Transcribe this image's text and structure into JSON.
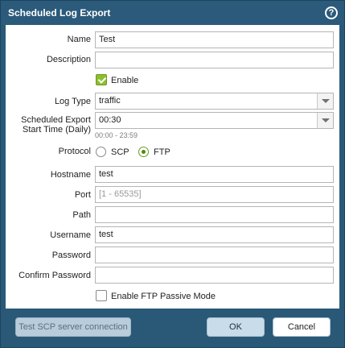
{
  "dialog": {
    "title": "Scheduled Log Export",
    "help_glyph": "?"
  },
  "form": {
    "name": {
      "label": "Name",
      "value": "Test"
    },
    "description": {
      "label": "Description",
      "value": ""
    },
    "enable": {
      "label": "Enable",
      "checked": true
    },
    "log_type": {
      "label": "Log Type",
      "value": "traffic"
    },
    "start_time": {
      "label_line1": "Scheduled Export",
      "label_line2": "Start Time (Daily)",
      "value": "00:30",
      "hint": "00:00 - 23:59"
    },
    "protocol": {
      "label": "Protocol",
      "options": [
        "SCP",
        "FTP"
      ],
      "selected": "FTP"
    },
    "hostname": {
      "label": "Hostname",
      "value": "test"
    },
    "port": {
      "label": "Port",
      "value": "",
      "placeholder": "[1 - 65535]"
    },
    "path": {
      "label": "Path",
      "value": ""
    },
    "username": {
      "label": "Username",
      "value": "test"
    },
    "password": {
      "label": "Password",
      "value": ""
    },
    "confirm_password": {
      "label": "Confirm Password",
      "value": ""
    },
    "passive_mode": {
      "label": "Enable FTP Passive Mode",
      "checked": false
    }
  },
  "footer": {
    "test_connection_label": "Test SCP server connection",
    "ok_label": "OK",
    "cancel_label": "Cancel"
  },
  "colors": {
    "titlebar": "#2b5a7a",
    "accent_green": "#8cbf2f",
    "button_disabled": "#b8ccdb"
  }
}
